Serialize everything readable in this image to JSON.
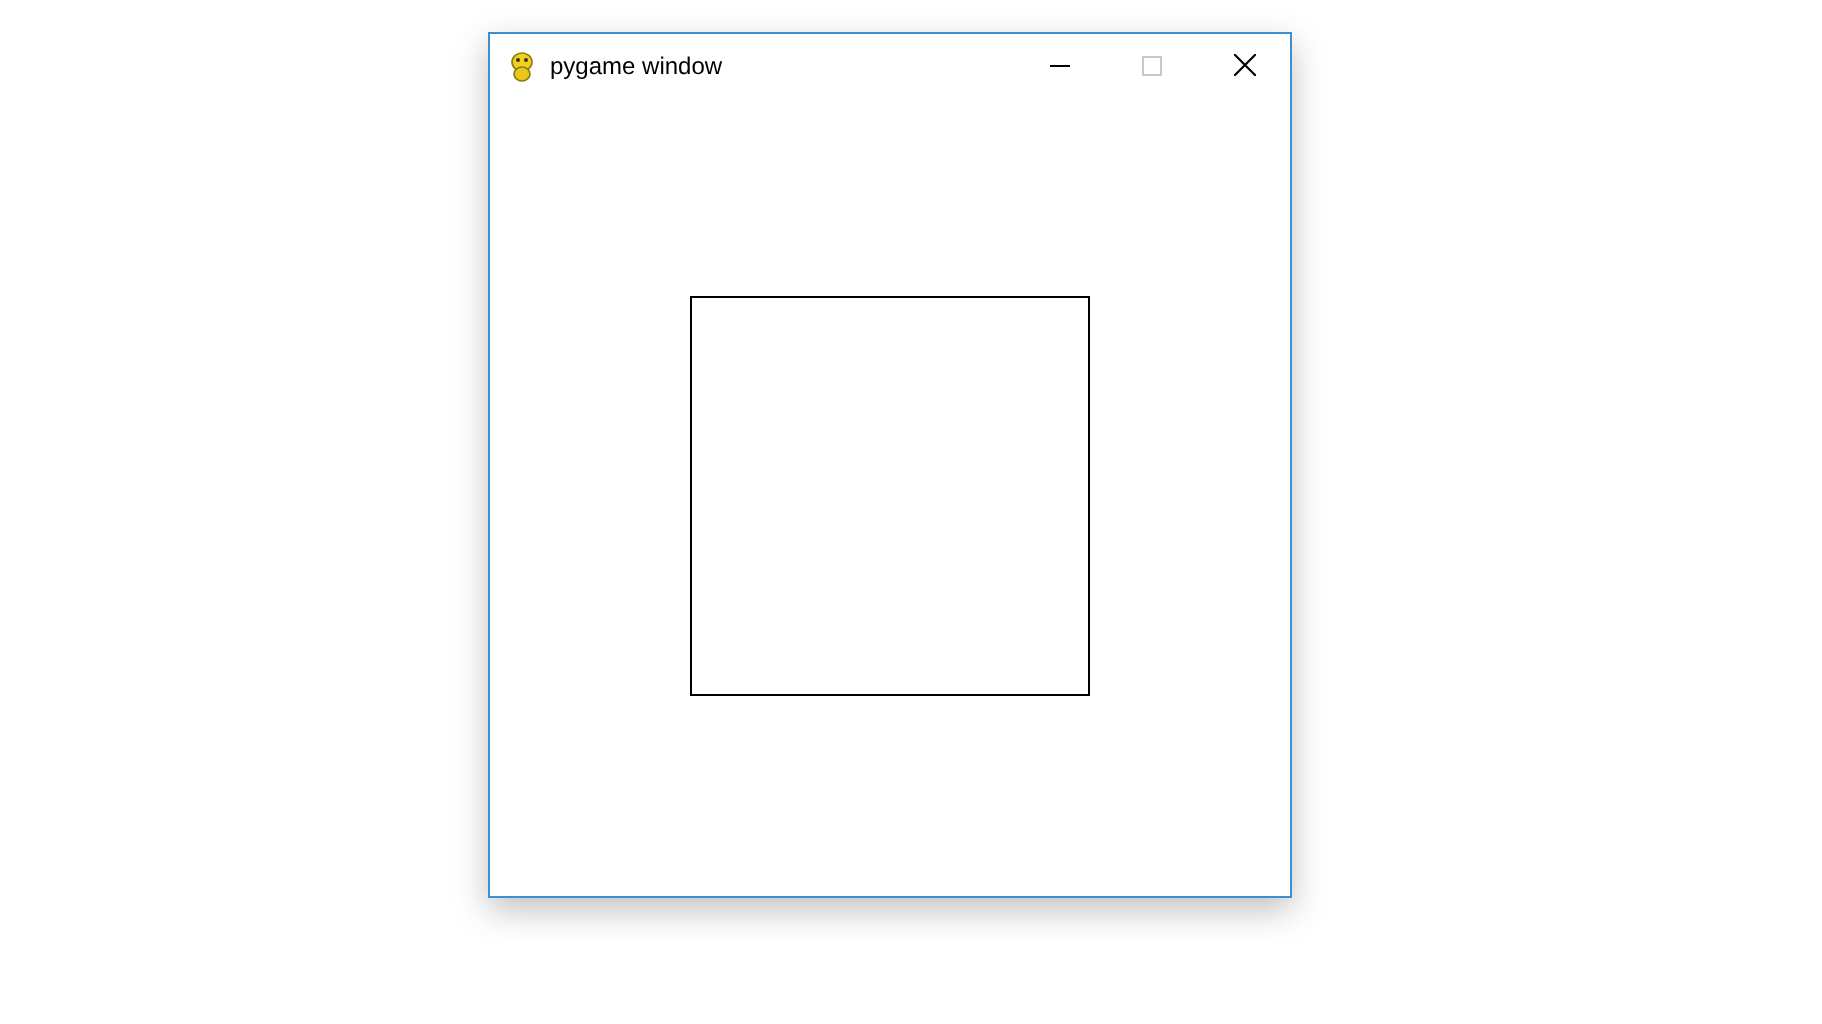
{
  "window": {
    "title": "pygame window",
    "maximize_disabled": true
  }
}
